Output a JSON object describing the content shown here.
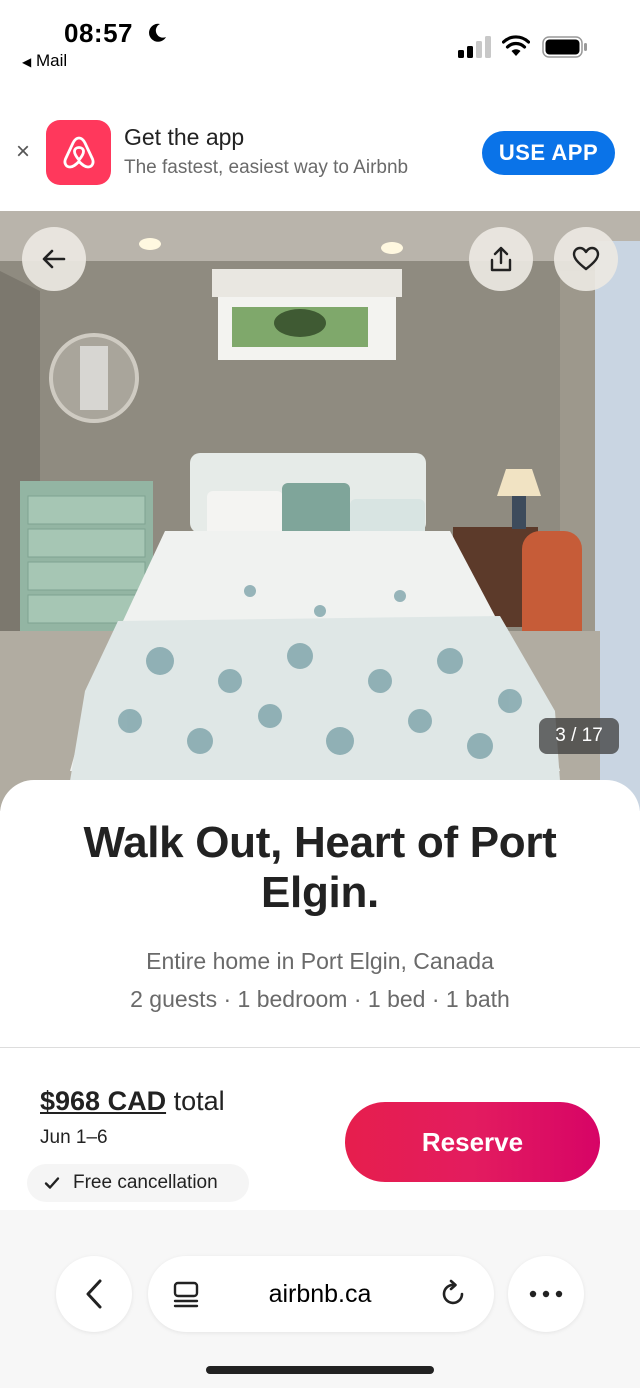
{
  "status_bar": {
    "time": "08:57",
    "back_label": "Mail"
  },
  "app_banner": {
    "title": "Get the app",
    "subtitle": "The fastest, easiest way to Airbnb",
    "button_label": "USE APP",
    "close_symbol": "×"
  },
  "photo": {
    "counter": "3 / 17"
  },
  "listing": {
    "title": "Walk Out, Heart of Port Elgin.",
    "type_location": "Entire home in Port Elgin, Canada",
    "details": "2 guests · 1 bedroom · 1 bed · 1 bath"
  },
  "booking": {
    "price": "$968 CAD",
    "price_suffix": "total",
    "dates": "Jun 1–6",
    "free_cancellation": "Free cancellation",
    "reserve_label": "Reserve"
  },
  "browser": {
    "url": "airbnb.ca"
  },
  "colors": {
    "brand": "#ff385c",
    "reserve": "#e31c5f",
    "use_app": "#0a73e8"
  }
}
